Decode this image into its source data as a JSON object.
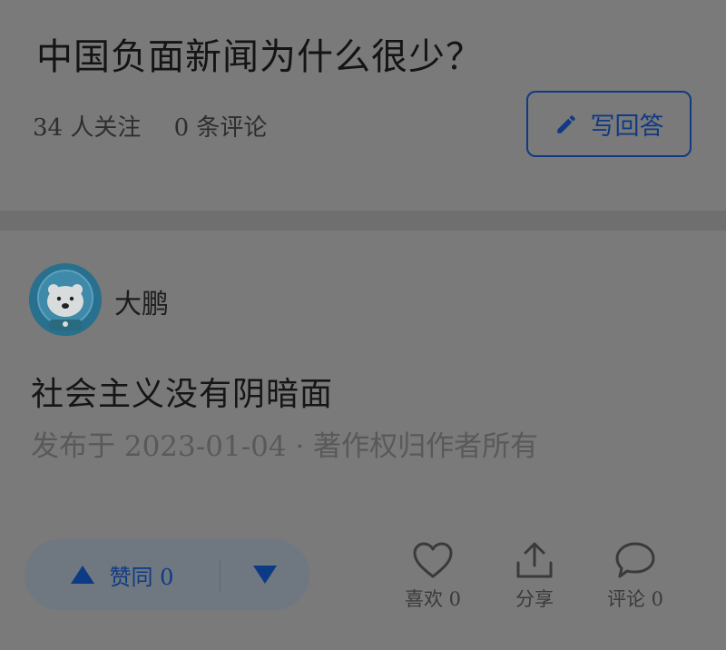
{
  "question": {
    "title": "中国负面新闻为什么很少？",
    "followers": "34 人关注",
    "comments": "0 条评论",
    "write_answer_label": "写回答"
  },
  "answer": {
    "author": "大鹏",
    "content": "社会主义没有阴暗面",
    "meta": "发布于 2023-01-04 · 著作权归作者所有"
  },
  "vote": {
    "upvote_label": "赞同 0"
  },
  "actions": {
    "like_label": "喜欢 0",
    "share_label": "分享",
    "comment_label": "评论 0"
  },
  "colors": {
    "accent": "#103a83",
    "background": "#7a7a7a",
    "vote_pill": "#6f7780"
  },
  "icons": [
    "pencil-icon",
    "upvote-triangle-icon",
    "downvote-triangle-icon",
    "heart-icon",
    "share-icon",
    "comment-bubble-icon"
  ]
}
